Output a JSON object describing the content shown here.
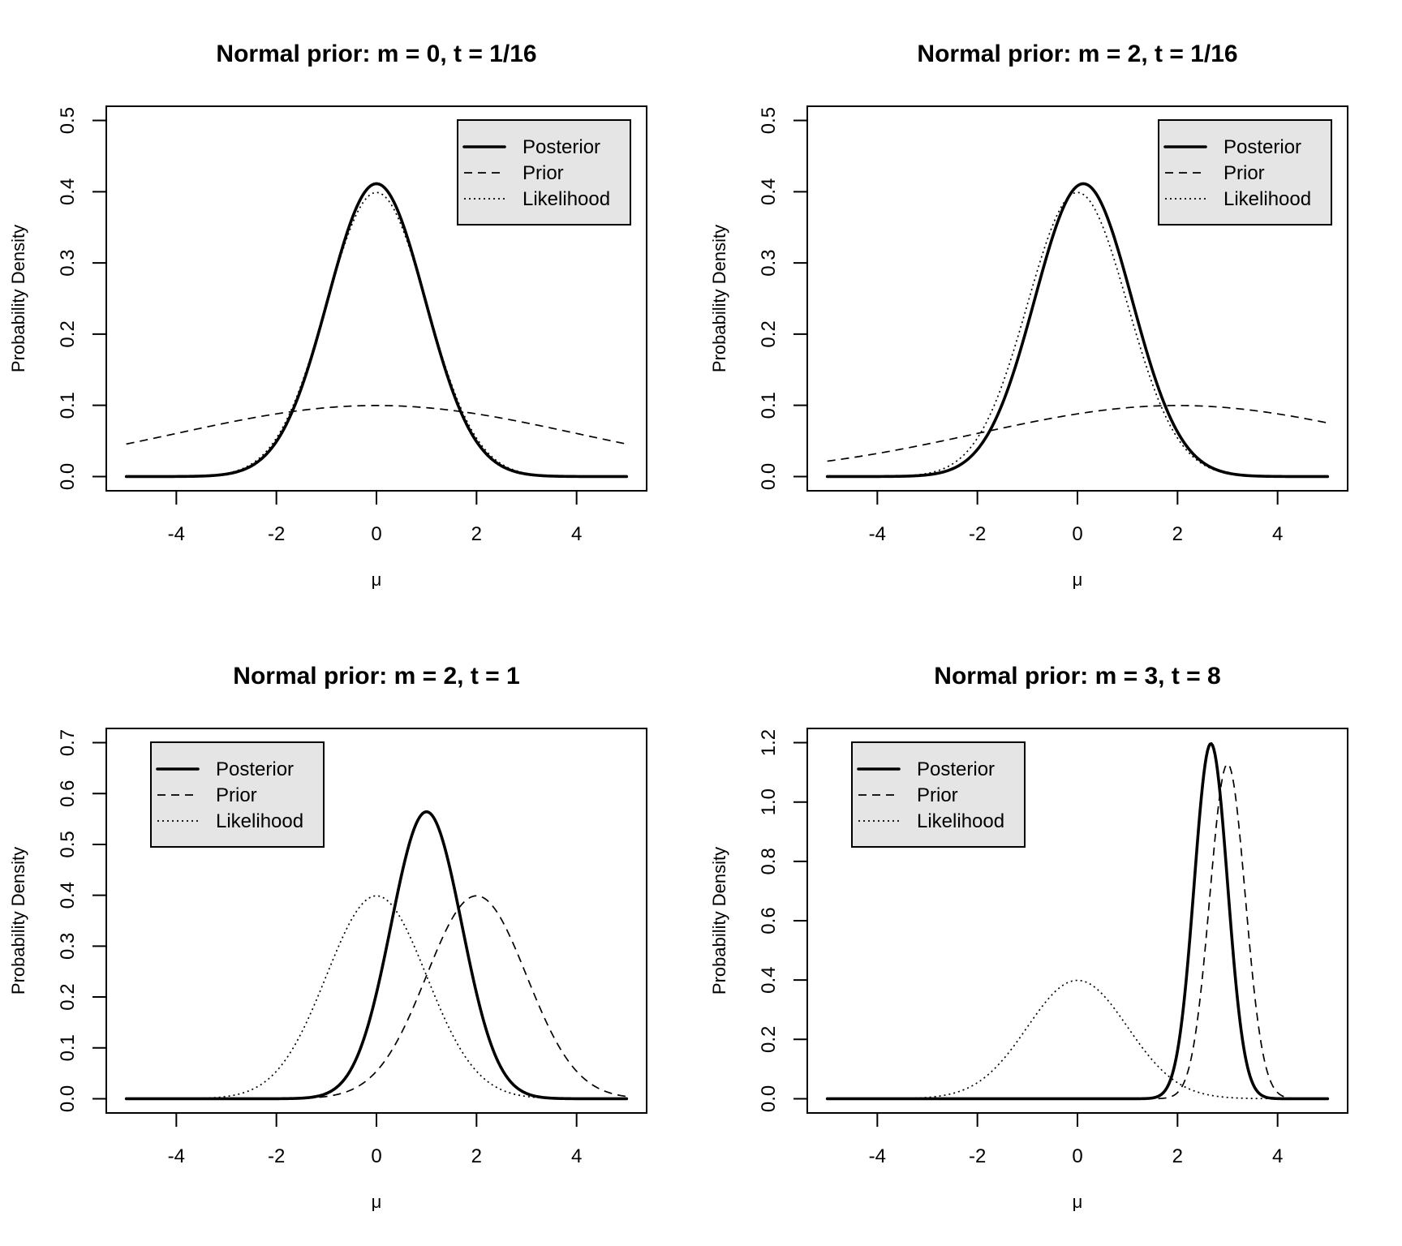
{
  "figure": {
    "layout": "2x2",
    "background": "#ffffff",
    "legend_fill": "#e5e5e5",
    "line_color": "#000000"
  },
  "chart_data": [
    {
      "type": "line",
      "title": "Normal prior: m = 0, t = 1/16",
      "xlabel": "μ",
      "ylabel": "Probability Density",
      "xlim": [
        -5,
        5
      ],
      "ylim": [
        0,
        0.5
      ],
      "xticks": [
        "-4",
        "-2",
        "0",
        "2",
        "4"
      ],
      "xtick_values": [
        -4,
        -2,
        0,
        2,
        4
      ],
      "yticks": [
        "0.0",
        "0.1",
        "0.2",
        "0.3",
        "0.4",
        "0.5"
      ],
      "ytick_values": [
        0,
        0.1,
        0.2,
        0.3,
        0.4,
        0.5
      ],
      "legend_position": "top-right",
      "grid": false,
      "series": [
        {
          "name": "Posterior",
          "style": "solid",
          "distribution": "normal",
          "mean": 0.0,
          "sd": 0.9701,
          "peak": 0.411
        },
        {
          "name": "Prior",
          "style": "dashed",
          "distribution": "normal",
          "mean": 0.0,
          "sd": 4.0,
          "peak": 0.0997
        },
        {
          "name": "Likelihood",
          "style": "dotted",
          "distribution": "normal",
          "mean": 0.0,
          "sd": 1.0,
          "peak": 0.3989
        }
      ]
    },
    {
      "type": "line",
      "title": "Normal prior: m = 2, t = 1/16",
      "xlabel": "μ",
      "ylabel": "Probability Density",
      "xlim": [
        -5,
        5
      ],
      "ylim": [
        0,
        0.5
      ],
      "xticks": [
        "-4",
        "-2",
        "0",
        "2",
        "4"
      ],
      "xtick_values": [
        -4,
        -2,
        0,
        2,
        4
      ],
      "yticks": [
        "0.0",
        "0.1",
        "0.2",
        "0.3",
        "0.4",
        "0.5"
      ],
      "ytick_values": [
        0,
        0.1,
        0.2,
        0.3,
        0.4,
        0.5
      ],
      "legend_position": "top-right",
      "grid": false,
      "series": [
        {
          "name": "Posterior",
          "style": "solid",
          "distribution": "normal",
          "mean": 0.1176,
          "sd": 0.9701,
          "peak": 0.411
        },
        {
          "name": "Prior",
          "style": "dashed",
          "distribution": "normal",
          "mean": 2.0,
          "sd": 4.0,
          "peak": 0.0997
        },
        {
          "name": "Likelihood",
          "style": "dotted",
          "distribution": "normal",
          "mean": 0.0,
          "sd": 1.0,
          "peak": 0.3989
        }
      ]
    },
    {
      "type": "line",
      "title": "Normal prior: m = 2, t = 1",
      "xlabel": "μ",
      "ylabel": "Probability Density",
      "xlim": [
        -5,
        5
      ],
      "ylim": [
        0,
        0.7
      ],
      "xticks": [
        "-4",
        "-2",
        "0",
        "2",
        "4"
      ],
      "xtick_values": [
        -4,
        -2,
        0,
        2,
        4
      ],
      "yticks": [
        "0.0",
        "0.1",
        "0.2",
        "0.3",
        "0.4",
        "0.5",
        "0.6",
        "0.7"
      ],
      "ytick_values": [
        0,
        0.1,
        0.2,
        0.3,
        0.4,
        0.5,
        0.6,
        0.7
      ],
      "legend_position": "top-left",
      "grid": false,
      "series": [
        {
          "name": "Posterior",
          "style": "solid",
          "distribution": "normal",
          "mean": 1.0,
          "sd": 0.7071,
          "peak": 0.5642
        },
        {
          "name": "Prior",
          "style": "dashed",
          "distribution": "normal",
          "mean": 2.0,
          "sd": 1.0,
          "peak": 0.3989
        },
        {
          "name": "Likelihood",
          "style": "dotted",
          "distribution": "normal",
          "mean": 0.0,
          "sd": 1.0,
          "peak": 0.3989
        }
      ]
    },
    {
      "type": "line",
      "title": "Normal prior: m = 3, t = 8",
      "xlabel": "μ",
      "ylabel": "Probability Density",
      "xlim": [
        -5,
        5
      ],
      "ylim": [
        0,
        1.2
      ],
      "xticks": [
        "-4",
        "-2",
        "0",
        "2",
        "4"
      ],
      "xtick_values": [
        -4,
        -2,
        0,
        2,
        4
      ],
      "yticks": [
        "0.0",
        "0.2",
        "0.4",
        "0.6",
        "0.8",
        "1.0",
        "1.2"
      ],
      "ytick_values": [
        0,
        0.2,
        0.4,
        0.6,
        0.8,
        1.0,
        1.2
      ],
      "legend_position": "top-left",
      "grid": false,
      "series": [
        {
          "name": "Posterior",
          "style": "solid",
          "distribution": "normal",
          "mean": 2.6667,
          "sd": 0.3333,
          "peak": 1.1968
        },
        {
          "name": "Prior",
          "style": "dashed",
          "distribution": "normal",
          "mean": 3.0,
          "sd": 0.3536,
          "peak": 1.1284
        },
        {
          "name": "Likelihood",
          "style": "dotted",
          "distribution": "normal",
          "mean": 0.0,
          "sd": 1.0,
          "peak": 0.3989
        }
      ]
    }
  ]
}
